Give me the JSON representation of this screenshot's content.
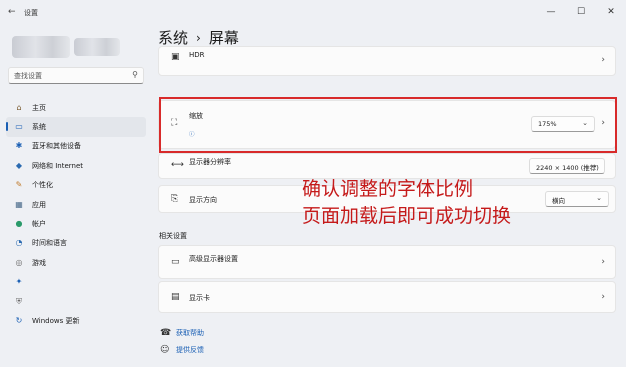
{
  "app": {
    "title": "设置"
  },
  "window_controls": {
    "minimize": "—",
    "maximize": "☐",
    "close": "✕"
  },
  "search": {
    "placeholder": "查找设置"
  },
  "sidebar": {
    "items": [
      {
        "label": "主页",
        "icon": "home-icon",
        "glyph": "⌂",
        "color": "#7a5a2e"
      },
      {
        "label": "系统",
        "icon": "system-icon",
        "glyph": "▭",
        "color": "#1a5fb4",
        "active": true
      },
      {
        "label": "蓝牙和其他设备",
        "icon": "bluetooth-icon",
        "glyph": "✱",
        "color": "#1a5fb4"
      },
      {
        "label": "网络和 Internet",
        "icon": "network-icon",
        "glyph": "◆",
        "color": "#2a6ab0"
      },
      {
        "label": "个性化",
        "icon": "brush-icon",
        "glyph": "✎",
        "color": "#c07a2a"
      },
      {
        "label": "应用",
        "icon": "apps-icon",
        "glyph": "▦",
        "color": "#4a6a8a"
      },
      {
        "label": "帐户",
        "icon": "account-icon",
        "glyph": "●",
        "color": "#2a9a6a"
      },
      {
        "label": "时间和语言",
        "icon": "clock-icon",
        "glyph": "◔",
        "color": "#2a6ab0"
      },
      {
        "label": "游戏",
        "icon": "game-icon",
        "glyph": "◎",
        "color": "#6a6a6a"
      },
      {
        "label": "",
        "icon": "accessibility-icon",
        "glyph": "✦",
        "color": "#1a5fb4"
      },
      {
        "label": "",
        "icon": "shield-icon",
        "glyph": "⛨",
        "color": "#6a6a6a"
      },
      {
        "label": "Windows 更新",
        "icon": "update-icon",
        "glyph": "↻",
        "color": "#1a5fb4"
      }
    ]
  },
  "breadcrumb": {
    "parent": "系统",
    "separator": "›",
    "current": "屏幕"
  },
  "hdr": {
    "title": "HDR",
    "subtitle": "",
    "badge": "HDR"
  },
  "scale_section": {
    "label": ""
  },
  "scale": {
    "title": "缩放",
    "subtitle": "",
    "note": "",
    "value": "175%"
  },
  "resolution": {
    "title": "显示器分辨率",
    "subtitle": "",
    "value": "2240 × 1400 (推荐)"
  },
  "orientation": {
    "title": "显示方向",
    "value": "横向"
  },
  "annotation": {
    "line1": "确认调整的字体比例",
    "line2": "页面加载后即可成功切换"
  },
  "related": {
    "label": "相关设置",
    "advanced_title": "高级显示器设置",
    "advanced_subtitle": "",
    "graphics_title": "显示卡"
  },
  "links": {
    "help": "获取帮助",
    "feedback": "提供反馈"
  },
  "colors": {
    "accent": "#1a5fb4",
    "highlight": "#d82a2a",
    "annotation": "#c51a1a"
  }
}
